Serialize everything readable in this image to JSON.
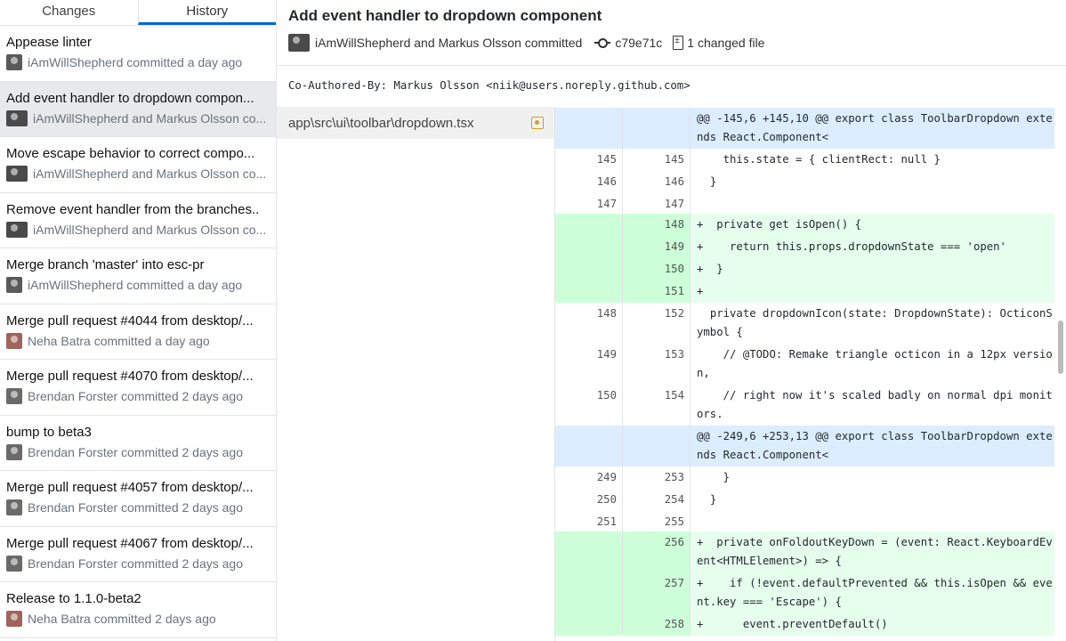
{
  "tabs": {
    "changes": "Changes",
    "history": "History"
  },
  "commits": [
    {
      "summary": "Appease linter",
      "meta": "iAmWillShepherd committed a day ago",
      "avatar_color": "#5a5a5a",
      "pair": false
    },
    {
      "summary": "Add event handler to dropdown compon...",
      "meta": "iAmWillShepherd and Markus Olsson co...",
      "avatar_color": "#4a4a4a",
      "pair": true
    },
    {
      "summary": "Move escape behavior to correct compo...",
      "meta": "iAmWillShepherd and Markus Olsson co...",
      "avatar_color": "#4a4a4a",
      "pair": true
    },
    {
      "summary": "Remove event handler from the branches..",
      "meta": "iAmWillShepherd and Markus Olsson co...",
      "avatar_color": "#4a4a4a",
      "pair": true
    },
    {
      "summary": "Merge branch 'master' into esc-pr",
      "meta": "iAmWillShepherd committed a day ago",
      "avatar_color": "#5a5a5a",
      "pair": false
    },
    {
      "summary": "Merge pull request #4044 from desktop/...",
      "meta": "Neha Batra committed a day ago",
      "avatar_color": "#a0655a",
      "pair": false
    },
    {
      "summary": "Merge pull request #4070 from desktop/...",
      "meta": "Brendan Forster committed 2 days ago",
      "avatar_color": "#6a6a6a",
      "pair": false
    },
    {
      "summary": "bump to beta3",
      "meta": "Brendan Forster committed 2 days ago",
      "avatar_color": "#6a6a6a",
      "pair": false
    },
    {
      "summary": "Merge pull request #4057 from desktop/...",
      "meta": "Brendan Forster committed 2 days ago",
      "avatar_color": "#6a6a6a",
      "pair": false
    },
    {
      "summary": "Merge pull request #4067 from desktop/...",
      "meta": "Brendan Forster committed 2 days ago",
      "avatar_color": "#6a6a6a",
      "pair": false
    },
    {
      "summary": "Release to 1.1.0-beta2",
      "meta": "Neha Batra committed 2 days ago",
      "avatar_color": "#a0655a",
      "pair": false
    }
  ],
  "selected_commit_index": 1,
  "header": {
    "title": "Add event handler to dropdown component",
    "authors": "iAmWillShepherd and Markus Olsson committed",
    "sha": "c79e71c",
    "changed_files": "1 changed file"
  },
  "description": "Co-Authored-By: Markus Olsson <niik@users.noreply.github.com>",
  "files": [
    {
      "path": "app\\src\\ui\\toolbar\\dropdown.tsx",
      "status": "modified"
    }
  ],
  "diff": [
    {
      "type": "hunk",
      "old": "",
      "new": "",
      "text": "@@ -145,6 +145,10 @@ export class ToolbarDropdown extends React.Component<"
    },
    {
      "type": "ctx",
      "old": "145",
      "new": "145",
      "text": "    this.state = { clientRect: null }"
    },
    {
      "type": "ctx",
      "old": "146",
      "new": "146",
      "text": "  }"
    },
    {
      "type": "ctx",
      "old": "147",
      "new": "147",
      "text": ""
    },
    {
      "type": "add",
      "old": "",
      "new": "148",
      "text": "+  private get isOpen() {"
    },
    {
      "type": "add",
      "old": "",
      "new": "149",
      "text": "+    return this.props.dropdownState === 'open'"
    },
    {
      "type": "add",
      "old": "",
      "new": "150",
      "text": "+  }"
    },
    {
      "type": "add",
      "old": "",
      "new": "151",
      "text": "+"
    },
    {
      "type": "ctx",
      "old": "148",
      "new": "152",
      "text": "  private dropdownIcon(state: DropdownState): OcticonSymbol {"
    },
    {
      "type": "ctx",
      "old": "149",
      "new": "153",
      "text": "    // @TODO: Remake triangle octicon in a 12px version,"
    },
    {
      "type": "ctx",
      "old": "150",
      "new": "154",
      "text": "    // right now it's scaled badly on normal dpi monitors."
    },
    {
      "type": "hunk",
      "old": "",
      "new": "",
      "text": "@@ -249,6 +253,13 @@ export class ToolbarDropdown extends React.Component<"
    },
    {
      "type": "ctx",
      "old": "249",
      "new": "253",
      "text": "    }"
    },
    {
      "type": "ctx",
      "old": "250",
      "new": "254",
      "text": "  }"
    },
    {
      "type": "ctx",
      "old": "251",
      "new": "255",
      "text": ""
    },
    {
      "type": "add",
      "old": "",
      "new": "256",
      "text": "+  private onFoldoutKeyDown = (event: React.KeyboardEvent<HTMLElement>) => {"
    },
    {
      "type": "add",
      "old": "",
      "new": "257",
      "text": "+    if (!event.defaultPrevented && this.isOpen && event.key === 'Escape') {"
    },
    {
      "type": "add",
      "old": "",
      "new": "258",
      "text": "+      event.preventDefault()"
    }
  ]
}
